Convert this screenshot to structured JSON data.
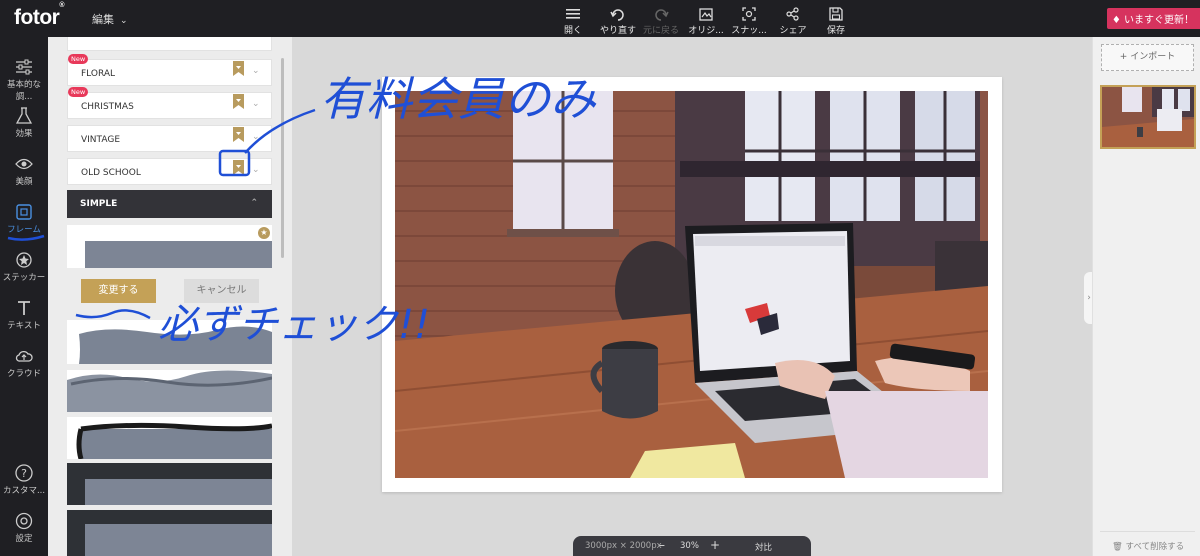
{
  "header": {
    "logo": "fotor",
    "logo_mark": "®",
    "edit_menu": "編集",
    "tools": [
      {
        "label": "開く",
        "icon": "hamburger-menu-icon"
      },
      {
        "label": "やり直す",
        "icon": "undo-icon"
      },
      {
        "label": "元に戻る",
        "icon": "redo-icon",
        "disabled": true
      },
      {
        "label": "オリジ...",
        "icon": "original-image-icon"
      },
      {
        "label": "スナッ...",
        "icon": "snapshot-icon"
      },
      {
        "label": "シェア",
        "icon": "share-icon"
      },
      {
        "label": "保存",
        "icon": "save-icon"
      }
    ],
    "upgrade_label": "いますぐ更新！"
  },
  "sidebar": {
    "items": [
      {
        "label": "基本的な調...",
        "icon": "sliders-icon"
      },
      {
        "label": "効果",
        "icon": "flask-icon"
      },
      {
        "label": "美顔",
        "icon": "eye-icon"
      },
      {
        "label": "フレーム",
        "icon": "frame-icon",
        "active": true
      },
      {
        "label": "ステッカー",
        "icon": "sticker-icon"
      },
      {
        "label": "テキスト",
        "icon": "text-icon"
      },
      {
        "label": "クラウド",
        "icon": "cloud-icon"
      },
      {
        "label": "カスタマ...",
        "icon": "help-icon"
      },
      {
        "label": "設定",
        "icon": "settings-icon"
      }
    ]
  },
  "frame_panel": {
    "categories": [
      {
        "label": "FLORAL",
        "badge": "New",
        "premium": true
      },
      {
        "label": "CHRISTMAS",
        "badge": "New",
        "premium": true
      },
      {
        "label": "VINTAGE",
        "badge": "",
        "premium": true
      },
      {
        "label": "OLD SCHOOL",
        "badge": "",
        "premium": true
      }
    ],
    "open_category": "SIMPLE",
    "apply_label": "変更する",
    "cancel_label": "キャンセル"
  },
  "annotations": {
    "premium_note": "有料会員のみ",
    "check_note": "必ずチェック!!"
  },
  "right_panel": {
    "import_label": "+ インポート",
    "clear_all_label": "すべて削除する"
  },
  "bottom_bar": {
    "dimensions": "3000px × 2000px",
    "zoom": "30%",
    "compare_label": "対比"
  },
  "colors": {
    "accent_gold": "#c4a157",
    "badge_red": "#e8395a",
    "upgrade_pink": "#d6335e",
    "dark_ui": "#1f1f23",
    "annotation_blue": "#1f4fd6"
  }
}
